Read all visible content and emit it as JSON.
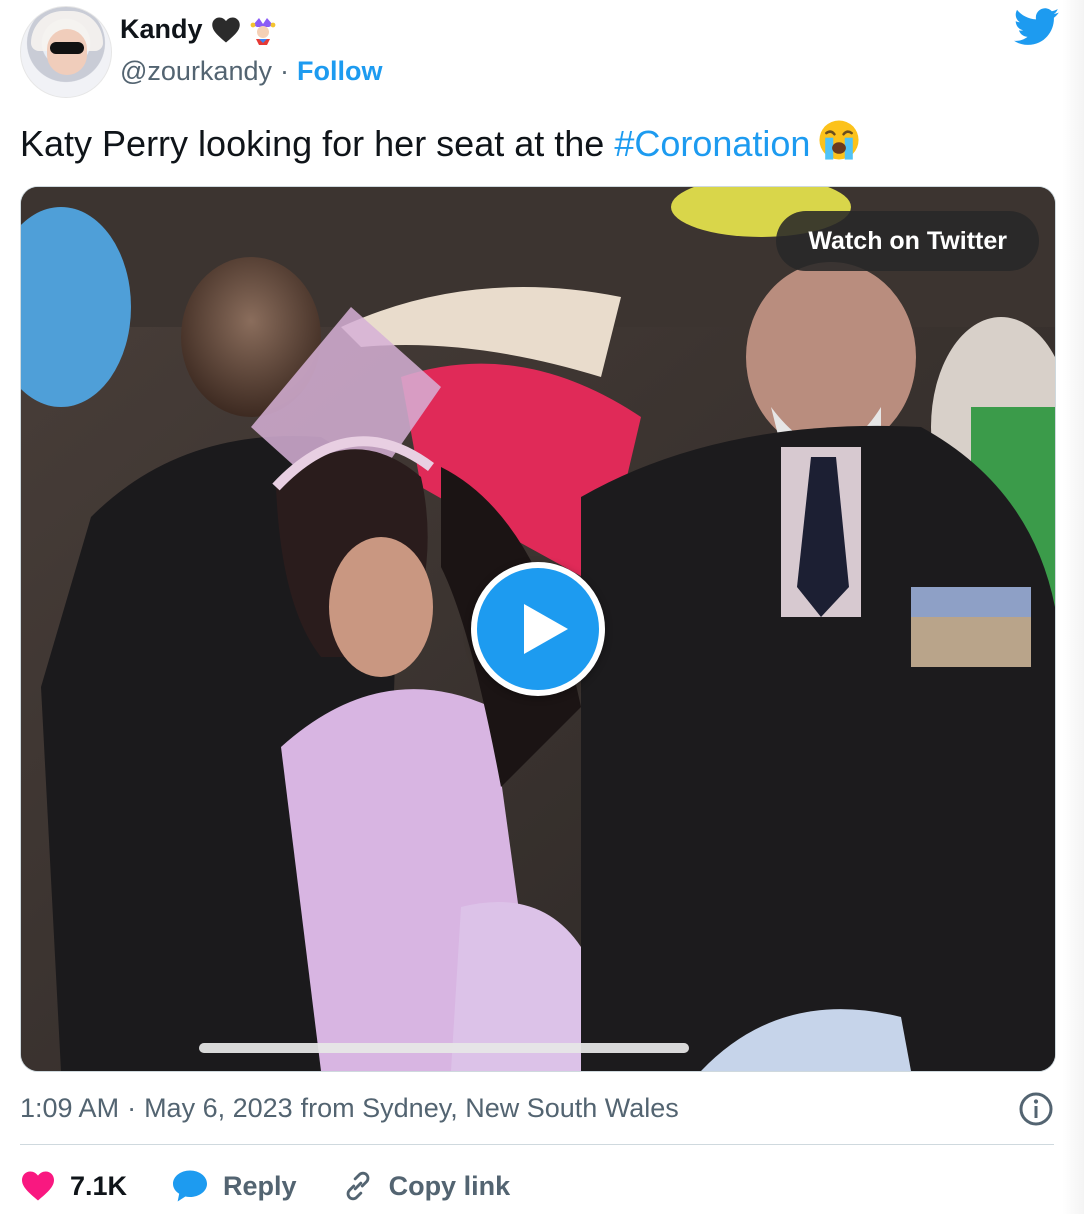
{
  "user": {
    "display_name": "Kandy",
    "handle": "@zourkandy",
    "separator": "·",
    "follow_label": "Follow",
    "badges": [
      "black-heart-icon",
      "jester-icon"
    ]
  },
  "tweet": {
    "text_prefix": "Katy Perry looking for her seat at the ",
    "hashtag": "#Coronation",
    "emoji": "loudly-crying-face-icon"
  },
  "media": {
    "watch_label": "Watch on Twitter",
    "progress": 0.0
  },
  "meta": {
    "time": "1:09 AM",
    "separator": "·",
    "date": "May 6, 2023",
    "location_text": "from Sydney, New South Wales"
  },
  "actions": {
    "like_count": "7.1K",
    "reply_label": "Reply",
    "copy_link_label": "Copy link"
  },
  "colors": {
    "accent": "#1d9bf0",
    "like": "#f91880",
    "text_primary": "#0f1419",
    "text_secondary": "#536471"
  }
}
